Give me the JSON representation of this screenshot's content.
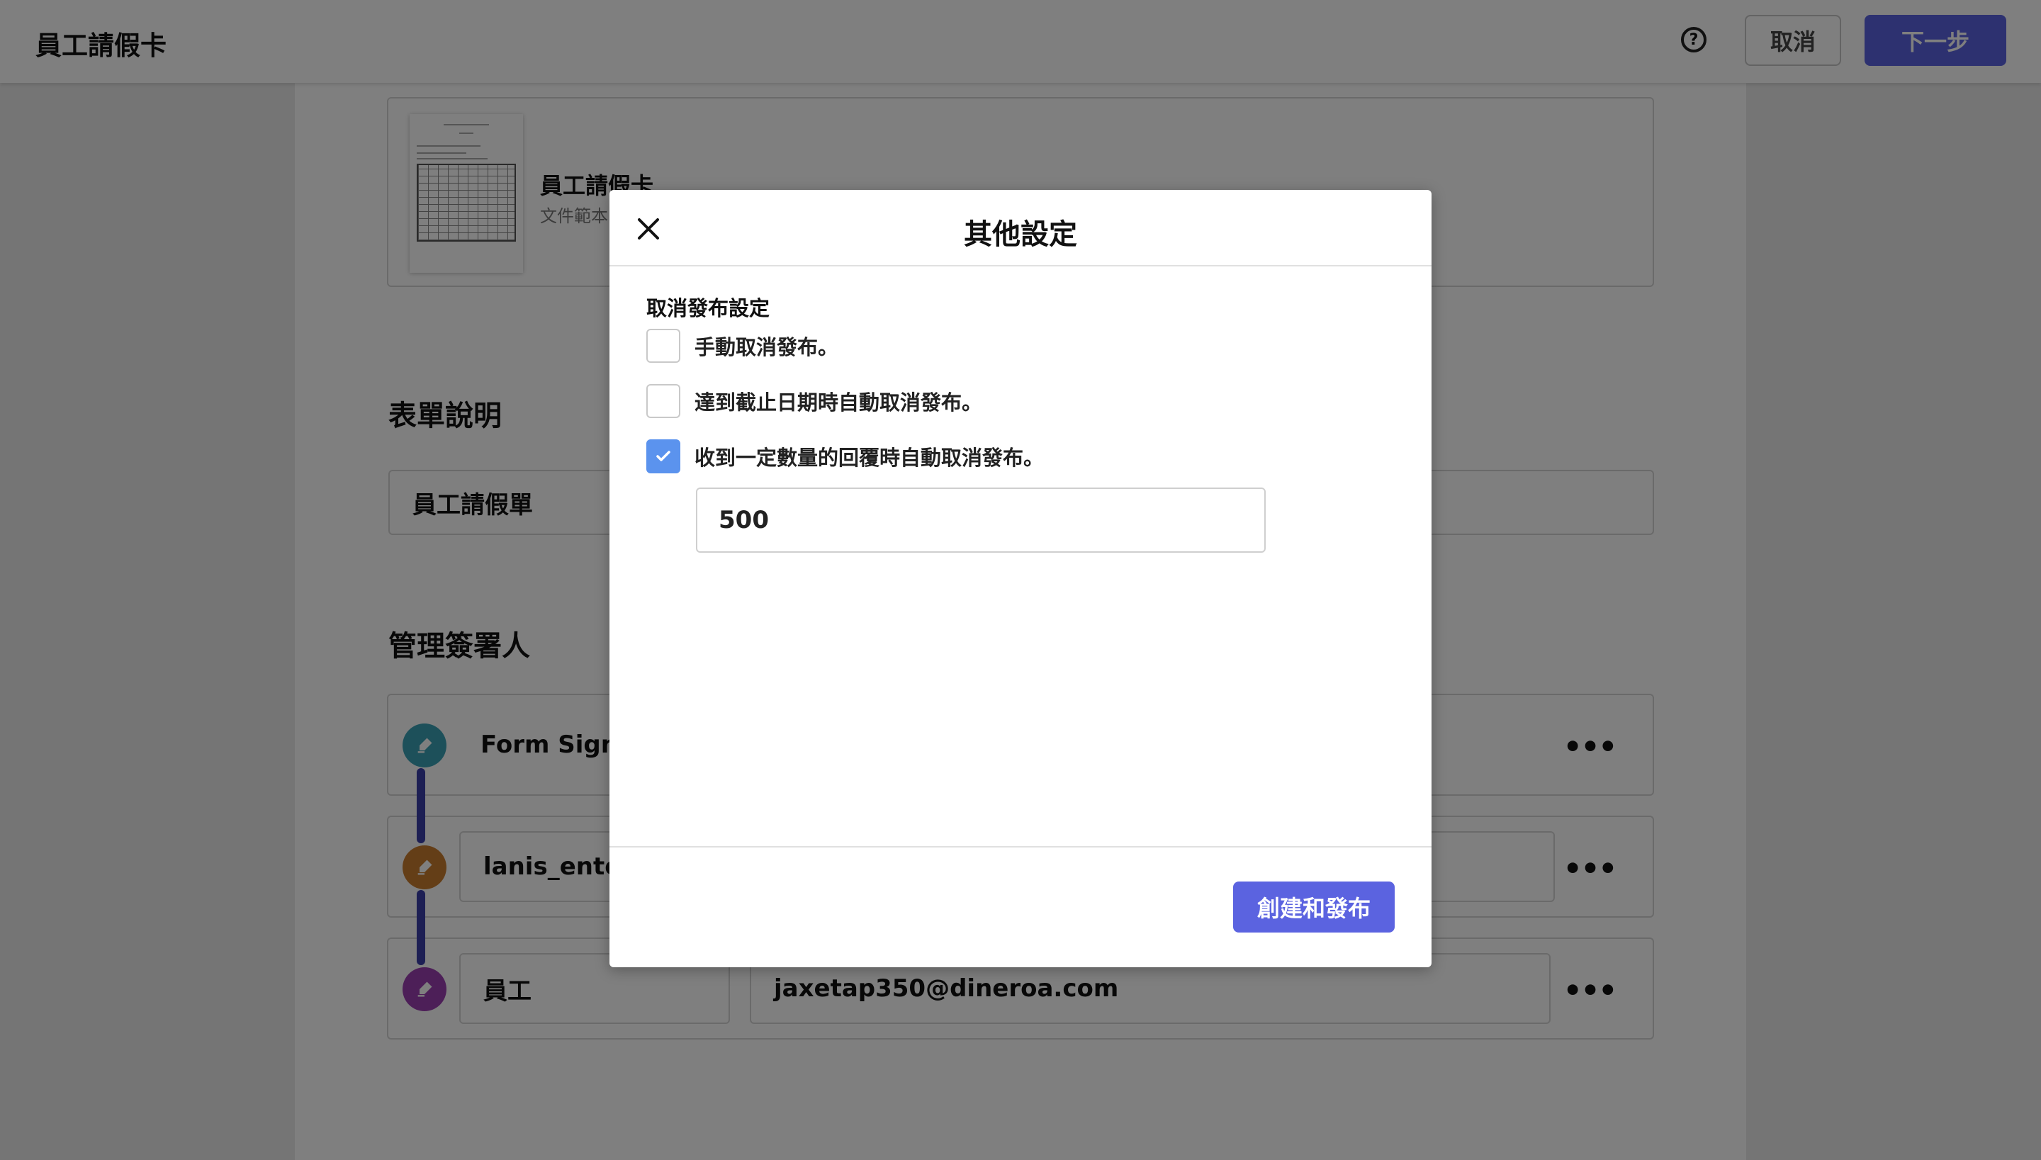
{
  "header": {
    "title": "員工請假卡",
    "help_icon": "question-circle-icon",
    "cancel_label": "取消",
    "next_label": "下一步"
  },
  "document": {
    "name": "員工請假卡",
    "type": "文件範本"
  },
  "description_section": {
    "title": "表單說明",
    "value": "員工請假單"
  },
  "signers_section": {
    "title": "管理簽署人",
    "signers": [
      {
        "name": "Form Signer",
        "color": "#3ba0b5"
      },
      {
        "name": "lanis_enterp",
        "color": "#c97c2f"
      },
      {
        "name": "員工",
        "email": "jaxetap350@dineroa.com",
        "color": "#9b3fb0"
      }
    ]
  },
  "modal": {
    "title": "其他設定",
    "close_icon": "close-icon",
    "group_title": "取消發布設定",
    "options": [
      {
        "label": "手動取消發布。",
        "checked": false
      },
      {
        "label": "達到截止日期時自動取消發布。",
        "checked": false
      },
      {
        "label": "收到一定數量的回覆時自動取消發布。",
        "checked": true
      }
    ],
    "response_count": "500",
    "publish_label": "創建和發布"
  },
  "colors": {
    "primary": "#5b63e0",
    "checkbox_checked": "#5b93ee",
    "connector": "#3a3fa8"
  }
}
